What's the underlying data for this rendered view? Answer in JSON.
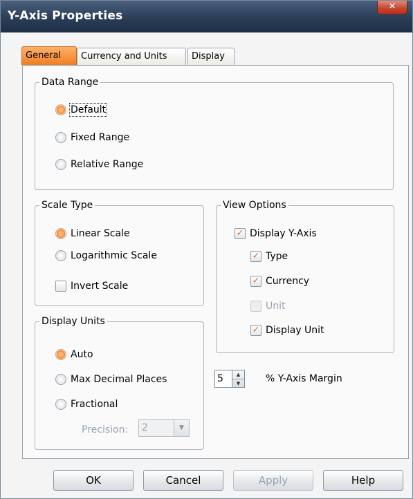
{
  "window": {
    "title": "Y-Axis Properties",
    "close_glyph": "✕"
  },
  "tabs": [
    {
      "label": "General",
      "active": true
    },
    {
      "label": "Currency and Units",
      "active": false
    },
    {
      "label": "Display",
      "active": false
    }
  ],
  "data_range": {
    "legend": "Data Range",
    "options": [
      {
        "label": "Default",
        "selected": true
      },
      {
        "label": "Fixed Range",
        "selected": false
      },
      {
        "label": "Relative Range",
        "selected": false
      }
    ]
  },
  "scale_type": {
    "legend": "Scale Type",
    "options": [
      {
        "label": "Linear Scale",
        "selected": true
      },
      {
        "label": "Logarithmic Scale",
        "selected": false
      }
    ],
    "invert": {
      "label": "Invert Scale",
      "checked": false
    }
  },
  "view_options": {
    "legend": "View Options",
    "display_y_axis": {
      "label": "Display Y-Axis",
      "checked": true
    },
    "items": [
      {
        "label": "Type",
        "checked": true,
        "enabled": true
      },
      {
        "label": "Currency",
        "checked": true,
        "enabled": true
      },
      {
        "label": "Unit",
        "checked": false,
        "enabled": false
      },
      {
        "label": "Display Unit",
        "checked": true,
        "enabled": true
      }
    ]
  },
  "margin": {
    "value": "5",
    "label": "% Y-Axis Margin"
  },
  "display_units": {
    "legend": "Display Units",
    "options": [
      {
        "label": "Auto",
        "selected": true
      },
      {
        "label": "Max Decimal Places",
        "selected": false
      },
      {
        "label": "Fractional",
        "selected": false
      }
    ],
    "precision": {
      "label": "Precision:",
      "value": "2"
    }
  },
  "buttons": {
    "ok": "OK",
    "cancel": "Cancel",
    "apply": "Apply",
    "help": "Help"
  },
  "icons": {
    "checkmark": "✓",
    "spin_up": "▲",
    "spin_down": "▼",
    "dropdown": "▼"
  },
  "colors": {
    "accent": "#f07e22",
    "titlebar": "#2b3d57"
  }
}
